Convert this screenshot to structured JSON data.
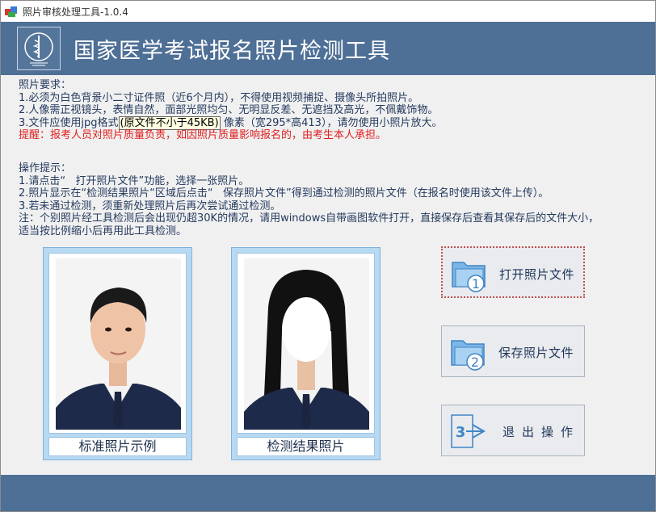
{
  "window": {
    "title": "照片审核处理工具-1.0.4"
  },
  "header": {
    "title": "国家医学考试报名照片检测工具"
  },
  "requirements": {
    "heading": "照片要求：",
    "line1": "1.必须为白色背景小二寸证件照（近6个月内），不得使用视频捕捉、摄像头所拍照片。",
    "line2": "2.人像需正视镜头，表情自然，面部光照均匀、无明显反差、无遮挡及高光，不佩戴饰物。",
    "line3_prefix": "3.文件应使用jpg格式",
    "line3_callout": "(原文件不小于45KB)",
    "line3_suffix": "像素（宽295*高413），请勿使用小照片放大。",
    "warning": "提醒：报考人员对照片质量负责，如因照片质量影响报名的，由考生本人承担。"
  },
  "operations": {
    "heading": "操作提示：",
    "line1": "1.请点击“   打开照片文件”功能，选择一张照片。",
    "line2": "2.照片显示在“检测结果照片“区域后点击“   保存照片文件”得到通过检测的照片文件（在报名时使用该文件上传）。",
    "line3": "3.若未通过检测，须重新处理照片后再次尝试通过检测。",
    "line4": "注：个别照片经工具检测后会出现仍超30K的情况，请用windows自带画图软件打开，直接保存后查看其保存后的文件大小，",
    "line5": "适当按比例缩小后再用此工具检测。"
  },
  "panels": {
    "standard_caption": "标准照片示例",
    "result_caption": "检测结果照片"
  },
  "buttons": {
    "open_label": "打开照片文件",
    "save_label": "保存照片文件",
    "exit_label": "退出操作",
    "open_badge": "1",
    "save_badge": "2",
    "exit_badge": "3"
  },
  "colors": {
    "header_bg": "#4e6f96",
    "warning": "#e02020",
    "panel_bg": "#b7d9f2"
  }
}
